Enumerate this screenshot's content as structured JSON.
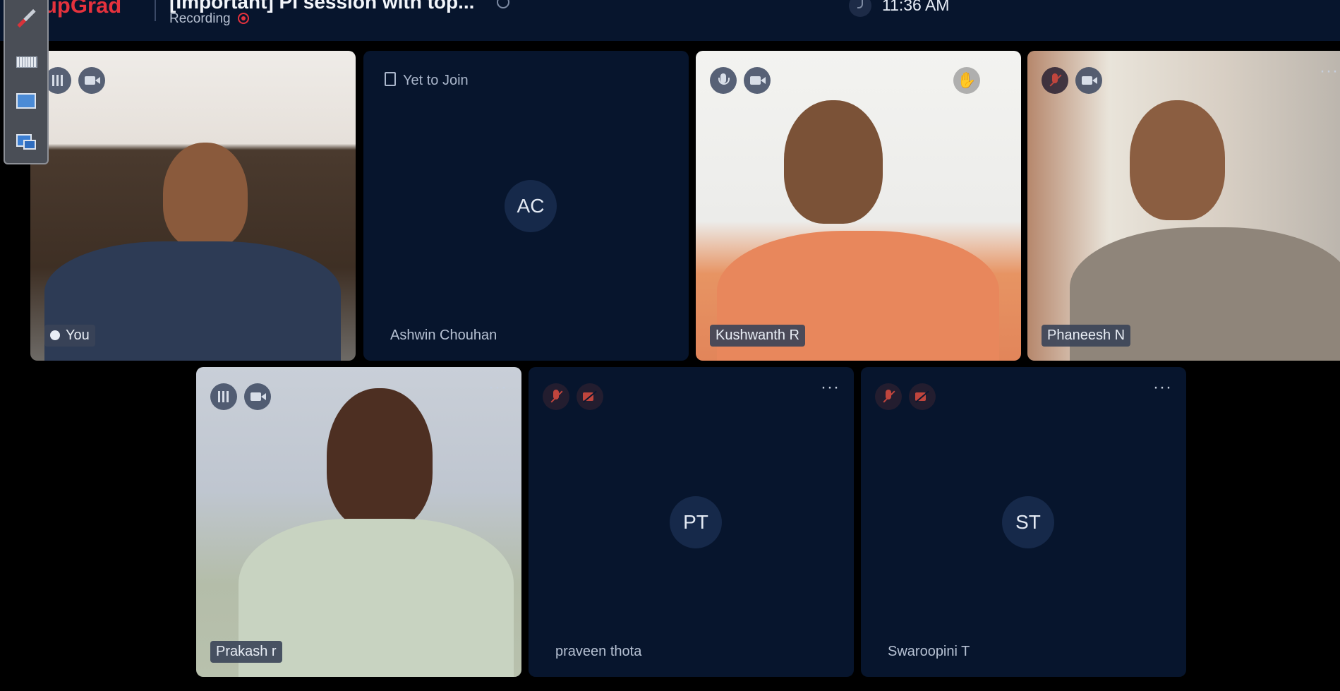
{
  "header": {
    "brand": "upGrad",
    "session_title": "[Important] PI session with top...",
    "recording_label": "Recording",
    "time": "11:36 AM"
  },
  "toolbar": {
    "tools": [
      "pen-icon",
      "keyboard-icon",
      "screen-capture-icon",
      "screen-share-icon"
    ]
  },
  "participants": [
    {
      "name": "You",
      "video": true,
      "mic": "speaking",
      "camera": "on"
    },
    {
      "name": "Ashwin Chouhan",
      "initials": "AC",
      "status": "Yet to Join",
      "video": false
    },
    {
      "name": "Kushwanth R",
      "video": true,
      "mic": "on",
      "camera": "on",
      "hand_raised": true
    },
    {
      "name": "Phaneesh N",
      "video": true,
      "mic": "muted",
      "camera": "on"
    },
    {
      "name": "Prakash r",
      "video": true,
      "mic": "speaking",
      "camera": "on"
    },
    {
      "name": "praveen thota",
      "initials": "PT",
      "video": false,
      "mic": "muted",
      "camera": "off"
    },
    {
      "name": "Swaroopini T",
      "initials": "ST",
      "video": false,
      "mic": "muted",
      "camera": "off"
    }
  ],
  "tile_menu_label": "···",
  "hand_icon_glyph": "✋",
  "colors": {
    "background": "#000000",
    "panel": "#07152d",
    "brand": "#e5323d",
    "hand": "#f4c542"
  }
}
